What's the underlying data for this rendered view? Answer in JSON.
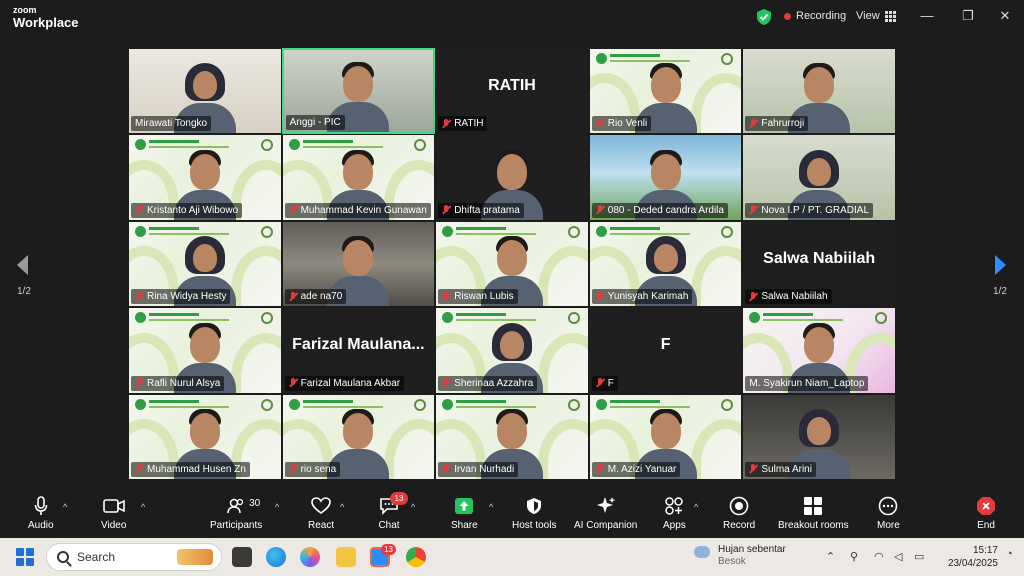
{
  "app": {
    "brand_small": "zoom",
    "brand_big": "Workplace",
    "recording_label": "Recording",
    "view_label": "View",
    "minimize_glyph": "—",
    "restore_glyph": "❐",
    "close_glyph": "✕"
  },
  "gallery": {
    "page_indicator": "1/2",
    "tiles": [
      {
        "name": "Mirawati Tongko",
        "muted": false,
        "big_name": "",
        "bg": "wall",
        "person": "hijab",
        "active": false
      },
      {
        "name": "Anggi - PIC",
        "muted": false,
        "big_name": "",
        "bg": "room",
        "person": "man",
        "active": true
      },
      {
        "name": "RATIH",
        "muted": true,
        "big_name": "RATIH",
        "bg": "black",
        "person": "",
        "active": false
      },
      {
        "name": "Rio Venli",
        "muted": true,
        "big_name": "",
        "bg": "green",
        "person": "man",
        "active": false
      },
      {
        "name": "Fahrurroji",
        "muted": true,
        "big_name": "",
        "bg": "office",
        "person": "man",
        "active": false
      },
      {
        "name": "Kristanto Aji Wibowo",
        "muted": true,
        "big_name": "",
        "bg": "green",
        "person": "man",
        "active": false
      },
      {
        "name": "Muhammad Kevin Gunawan",
        "muted": true,
        "big_name": "",
        "bg": "green",
        "person": "man",
        "active": false
      },
      {
        "name": "Dhifta pratama",
        "muted": true,
        "big_name": "",
        "bg": "black",
        "person": "man",
        "active": false
      },
      {
        "name": "080 - Deded candra Ardila",
        "muted": true,
        "big_name": "",
        "bg": "beach",
        "person": "man",
        "active": false
      },
      {
        "name": "Nova I.P / PT. GRADIAL",
        "muted": true,
        "big_name": "",
        "bg": "office",
        "person": "hijab",
        "active": false
      },
      {
        "name": "Rina Widya Hesty",
        "muted": true,
        "big_name": "",
        "bg": "green",
        "person": "hijab",
        "active": false
      },
      {
        "name": "ade na70",
        "muted": true,
        "big_name": "",
        "bg": "mine",
        "person": "man",
        "active": false
      },
      {
        "name": "Riswan Lubis",
        "muted": true,
        "big_name": "",
        "bg": "green",
        "person": "man",
        "active": false
      },
      {
        "name": "Yunisyah Karimah",
        "muted": true,
        "big_name": "",
        "bg": "green",
        "person": "hijab",
        "active": false
      },
      {
        "name": "Salwa Nabiilah",
        "muted": true,
        "big_name": "Salwa Nabiilah",
        "bg": "black",
        "person": "",
        "active": false
      },
      {
        "name": "Rafli Nurul Alsya",
        "muted": true,
        "big_name": "",
        "bg": "green",
        "person": "man",
        "active": false
      },
      {
        "name": "Farizal Maulana Akbar",
        "muted": true,
        "big_name": "Farizal  Maulana...",
        "bg": "black",
        "person": "",
        "active": false
      },
      {
        "name": "Sherinaa Azzahra",
        "muted": true,
        "big_name": "",
        "bg": "green",
        "person": "hijab",
        "active": false
      },
      {
        "name": "F",
        "muted": true,
        "big_name": "F",
        "bg": "black",
        "person": "",
        "active": false
      },
      {
        "name": "M. Syakirun Niam_Laptop",
        "muted": false,
        "big_name": "",
        "bg": "pink",
        "person": "man",
        "active": false
      },
      {
        "name": "Muhammad Husen Zn",
        "muted": true,
        "big_name": "",
        "bg": "green",
        "person": "man",
        "active": false
      },
      {
        "name": "rio sena",
        "muted": true,
        "big_name": "",
        "bg": "green",
        "person": "man",
        "active": false
      },
      {
        "name": "Irvan Nurhadi",
        "muted": true,
        "big_name": "",
        "bg": "green",
        "person": "man",
        "active": false
      },
      {
        "name": "M. Azizi Yanuar",
        "muted": true,
        "big_name": "",
        "bg": "green",
        "person": "man",
        "active": false
      },
      {
        "name": "Sulma Arini",
        "muted": true,
        "big_name": "",
        "bg": "dim",
        "person": "hijab",
        "active": false
      }
    ]
  },
  "toolbar": {
    "audio": "Audio",
    "video": "Video",
    "participants": "Participants",
    "participants_count": "30",
    "react": "React",
    "chat": "Chat",
    "chat_badge": "13",
    "share": "Share",
    "host_tools": "Host tools",
    "ai_companion": "AI Companion",
    "apps": "Apps",
    "record": "Record",
    "breakout": "Breakout rooms",
    "more": "More",
    "end": "End"
  },
  "taskbar": {
    "search_label": "Search",
    "weather_title": "Hujan sebentar",
    "weather_sub": "Besok",
    "time": "15:17",
    "date": "23/04/2025",
    "zoom_badge": "13"
  },
  "colors": {
    "active_border": "#3ddc84",
    "muted_red": "#e23b3b",
    "share_green": "#22c55e",
    "recording_red": "#e23b3b"
  }
}
